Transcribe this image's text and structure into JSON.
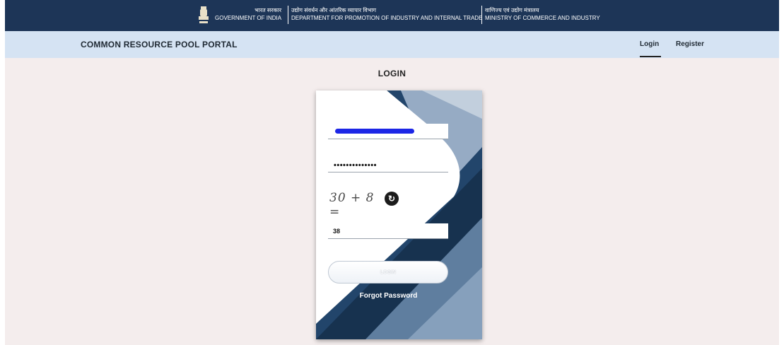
{
  "gov_header": {
    "gov_hi": "भारत सरकार",
    "gov_en": "GOVERNMENT OF INDIA",
    "dept_hi": "उद्योग संवर्धन और आंतरिक व्यापार विभाग",
    "dept_en": "DEPARTMENT FOR PROMOTION OF INDUSTRY AND INTERNAL TRADE",
    "ministry_hi": "वाणिज्य एवं उद्योग मंत्रालय",
    "ministry_en": "MINISTRY OF COMMERCE AND INDUSTRY"
  },
  "portal": {
    "title": "COMMON RESOURCE POOL PORTAL",
    "nav": {
      "login": "Login",
      "register": "Register"
    }
  },
  "login_form": {
    "heading": "LOGIN",
    "password_value": "••••••••••••••",
    "captcha_image_text": "30 + 8 =",
    "captcha_answer": "38",
    "submit_label": "LOGIN",
    "forgot_label": "Forgot Password"
  },
  "icons": {
    "emblem": "national-emblem-icon",
    "refresh": "refresh-icon"
  },
  "colors": {
    "gov_bar": "#1d3557",
    "portal_bar": "#d5e3f3",
    "page_bg": "#f4eded",
    "card_dark": "#22456b",
    "redaction": "#1c26e6"
  }
}
